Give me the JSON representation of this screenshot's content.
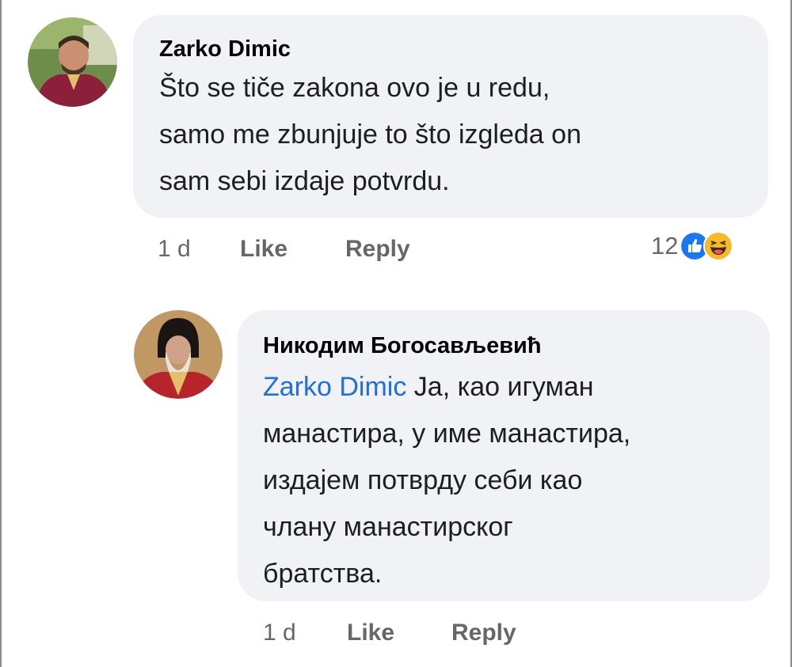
{
  "comment": {
    "author": "Zarko Dimic",
    "lines": [
      "Što se tiče zakona ovo je u redu,",
      "samo me zbunjuje to što izgleda on",
      "sam sebi izdaje potvrdu."
    ],
    "time": "1 d",
    "like_label": "Like",
    "reply_label": "Reply",
    "reaction_count": "12",
    "reaction_icons": [
      "like-icon",
      "haha-icon"
    ]
  },
  "reply": {
    "author": "Никодим Богосављевић",
    "mention": "Zarko Dimic",
    "first_line_rest": " Ја, као игуман",
    "lines": [
      "манастира, у име манастира,",
      "издајем потврду себи као",
      "члану манастирског",
      "братства."
    ],
    "time": "1 d",
    "like_label": "Like",
    "reply_label": "Reply"
  },
  "colors": {
    "bubble": "#f0f2f5",
    "mention": "#216fdb",
    "meta": "#65676b",
    "like_blue": "#1877f2",
    "haha_yellow": "#f7b928"
  }
}
